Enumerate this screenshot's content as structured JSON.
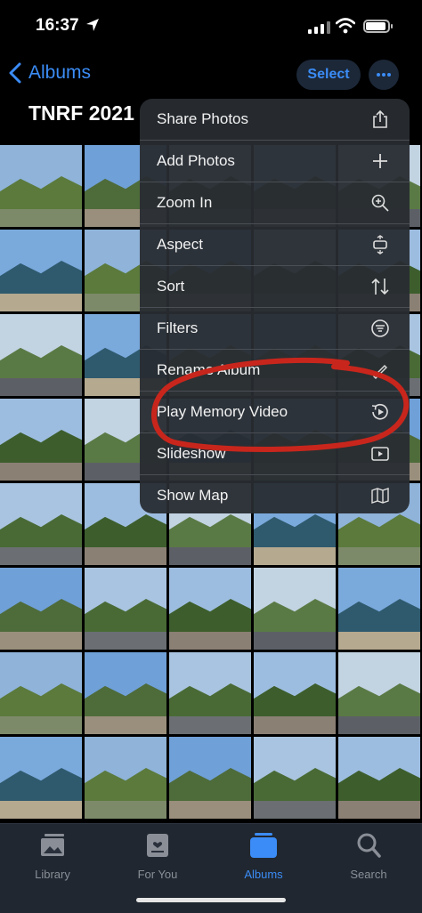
{
  "status_bar": {
    "time": "16:37"
  },
  "nav": {
    "back_label": "Albums",
    "select_label": "Select"
  },
  "album": {
    "title": "TNRF 2021"
  },
  "menu": {
    "items": [
      {
        "label": "Share Photos",
        "icon": "share-icon"
      },
      {
        "label": "Add Photos",
        "icon": "plus-icon"
      },
      {
        "label": "Zoom In",
        "icon": "zoom-in-icon"
      },
      {
        "label": "Aspect",
        "icon": "aspect-icon"
      },
      {
        "label": "Sort",
        "icon": "sort-icon"
      },
      {
        "label": "Filters",
        "icon": "filter-icon"
      },
      {
        "label": "Rename Album",
        "icon": "pencil-icon"
      },
      {
        "label": "Play Memory Video",
        "icon": "memory-video-icon"
      },
      {
        "label": "Slideshow",
        "icon": "play-icon"
      },
      {
        "label": "Show Map",
        "icon": "map-icon"
      }
    ]
  },
  "tabs": [
    {
      "label": "Library",
      "icon": "library-icon",
      "active": false
    },
    {
      "label": "For You",
      "icon": "for-you-icon",
      "active": false
    },
    {
      "label": "Albums",
      "icon": "albums-icon",
      "active": true
    },
    {
      "label": "Search",
      "icon": "search-icon",
      "active": false
    }
  ],
  "colors": {
    "accent": "#3b8cf6",
    "annotation": "#c8261c"
  }
}
